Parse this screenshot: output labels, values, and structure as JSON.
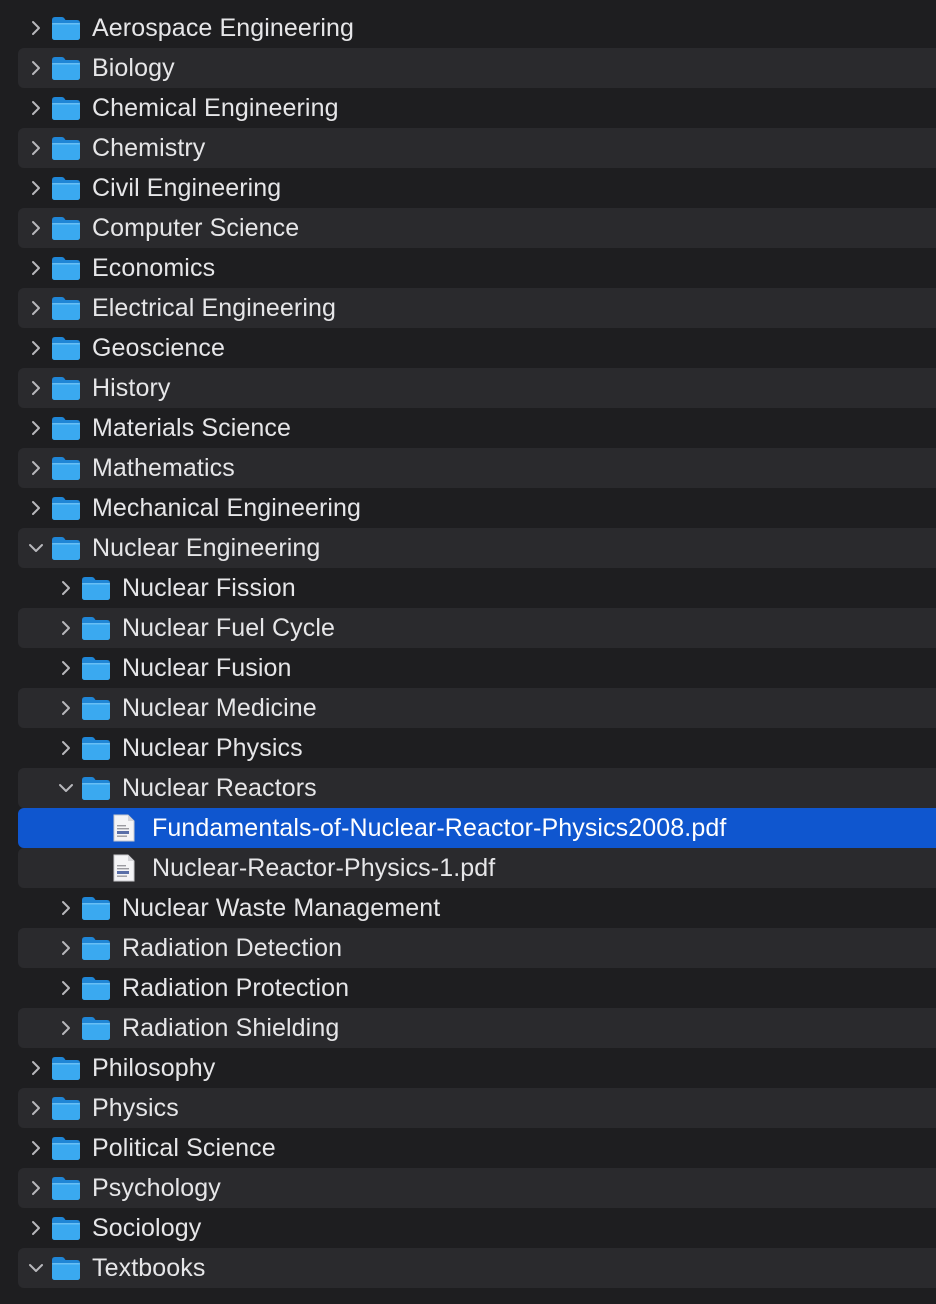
{
  "colors": {
    "background": "#1e1e20",
    "stripe": "#2a2a2d",
    "selection": "#0f56cf",
    "folder": "#3aa9f0",
    "text": "#e6e6e8"
  },
  "items": [
    {
      "label": "Aerospace Engineering",
      "type": "folder",
      "depth": 0,
      "expanded": false,
      "selected": false,
      "icon": "folder-icon"
    },
    {
      "label": "Biology",
      "type": "folder",
      "depth": 0,
      "expanded": false,
      "selected": false,
      "icon": "folder-icon"
    },
    {
      "label": "Chemical Engineering",
      "type": "folder",
      "depth": 0,
      "expanded": false,
      "selected": false,
      "icon": "folder-icon"
    },
    {
      "label": "Chemistry",
      "type": "folder",
      "depth": 0,
      "expanded": false,
      "selected": false,
      "icon": "folder-icon"
    },
    {
      "label": "Civil Engineering",
      "type": "folder",
      "depth": 0,
      "expanded": false,
      "selected": false,
      "icon": "folder-icon"
    },
    {
      "label": "Computer Science",
      "type": "folder",
      "depth": 0,
      "expanded": false,
      "selected": false,
      "icon": "folder-icon"
    },
    {
      "label": "Economics",
      "type": "folder",
      "depth": 0,
      "expanded": false,
      "selected": false,
      "icon": "folder-icon"
    },
    {
      "label": "Electrical Engineering",
      "type": "folder",
      "depth": 0,
      "expanded": false,
      "selected": false,
      "icon": "folder-icon"
    },
    {
      "label": "Geoscience",
      "type": "folder",
      "depth": 0,
      "expanded": false,
      "selected": false,
      "icon": "folder-icon"
    },
    {
      "label": "History",
      "type": "folder",
      "depth": 0,
      "expanded": false,
      "selected": false,
      "icon": "folder-icon"
    },
    {
      "label": "Materials Science",
      "type": "folder",
      "depth": 0,
      "expanded": false,
      "selected": false,
      "icon": "folder-icon"
    },
    {
      "label": "Mathematics",
      "type": "folder",
      "depth": 0,
      "expanded": false,
      "selected": false,
      "icon": "folder-icon"
    },
    {
      "label": "Mechanical Engineering",
      "type": "folder",
      "depth": 0,
      "expanded": false,
      "selected": false,
      "icon": "folder-icon"
    },
    {
      "label": "Nuclear Engineering",
      "type": "folder",
      "depth": 0,
      "expanded": true,
      "selected": false,
      "icon": "folder-icon"
    },
    {
      "label": "Nuclear Fission",
      "type": "folder",
      "depth": 1,
      "expanded": false,
      "selected": false,
      "icon": "folder-icon"
    },
    {
      "label": "Nuclear Fuel Cycle",
      "type": "folder",
      "depth": 1,
      "expanded": false,
      "selected": false,
      "icon": "folder-icon"
    },
    {
      "label": "Nuclear Fusion",
      "type": "folder",
      "depth": 1,
      "expanded": false,
      "selected": false,
      "icon": "folder-icon"
    },
    {
      "label": "Nuclear Medicine",
      "type": "folder",
      "depth": 1,
      "expanded": false,
      "selected": false,
      "icon": "folder-icon"
    },
    {
      "label": "Nuclear Physics",
      "type": "folder",
      "depth": 1,
      "expanded": false,
      "selected": false,
      "icon": "folder-icon"
    },
    {
      "label": "Nuclear Reactors",
      "type": "folder",
      "depth": 1,
      "expanded": true,
      "selected": false,
      "icon": "folder-icon"
    },
    {
      "label": "Fundamentals-of-Nuclear-Reactor-Physics2008.pdf",
      "type": "file",
      "depth": 2,
      "expanded": false,
      "selected": true,
      "icon": "pdf-file-icon"
    },
    {
      "label": "Nuclear-Reactor-Physics-1.pdf",
      "type": "file",
      "depth": 2,
      "expanded": false,
      "selected": false,
      "icon": "pdf-file-icon"
    },
    {
      "label": "Nuclear Waste Management",
      "type": "folder",
      "depth": 1,
      "expanded": false,
      "selected": false,
      "icon": "folder-icon"
    },
    {
      "label": "Radiation Detection",
      "type": "folder",
      "depth": 1,
      "expanded": false,
      "selected": false,
      "icon": "folder-icon"
    },
    {
      "label": "Radiation Protection",
      "type": "folder",
      "depth": 1,
      "expanded": false,
      "selected": false,
      "icon": "folder-icon"
    },
    {
      "label": "Radiation Shielding",
      "type": "folder",
      "depth": 1,
      "expanded": false,
      "selected": false,
      "icon": "folder-icon"
    },
    {
      "label": "Philosophy",
      "type": "folder",
      "depth": 0,
      "expanded": false,
      "selected": false,
      "icon": "folder-icon"
    },
    {
      "label": "Physics",
      "type": "folder",
      "depth": 0,
      "expanded": false,
      "selected": false,
      "icon": "folder-icon"
    },
    {
      "label": "Political Science",
      "type": "folder",
      "depth": 0,
      "expanded": false,
      "selected": false,
      "icon": "folder-icon"
    },
    {
      "label": "Psychology",
      "type": "folder",
      "depth": 0,
      "expanded": false,
      "selected": false,
      "icon": "folder-icon"
    },
    {
      "label": "Sociology",
      "type": "folder",
      "depth": 0,
      "expanded": false,
      "selected": false,
      "icon": "folder-icon"
    },
    {
      "label": "Textbooks",
      "type": "folder",
      "depth": 0,
      "expanded": true,
      "selected": false,
      "icon": "folder-icon"
    }
  ]
}
